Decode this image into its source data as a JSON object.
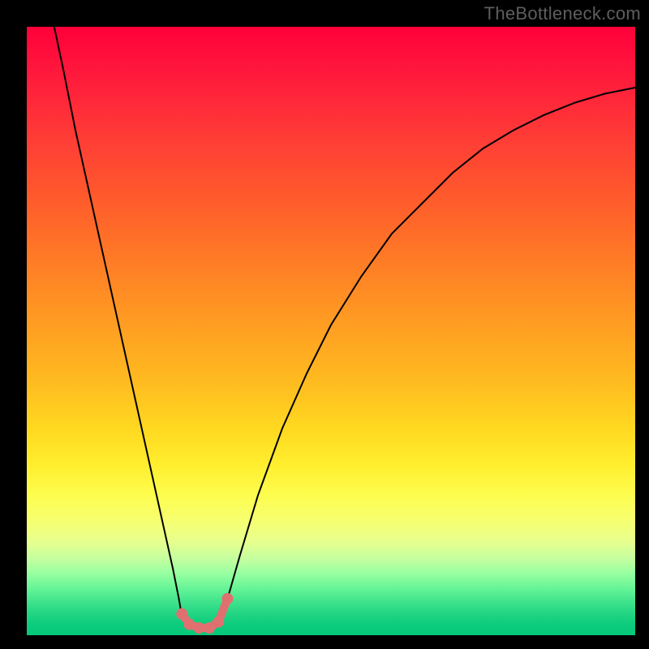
{
  "watermark": "TheBottleneck.com",
  "colors": {
    "frame": "#000000",
    "curve": "#000000",
    "marker": "#e07070",
    "gradient_top": "#ff003a",
    "gradient_bottom": "#04c878"
  },
  "chart_data": {
    "type": "line",
    "title": "",
    "xlabel": "",
    "ylabel": "",
    "xlim": [
      0,
      100
    ],
    "ylim": [
      0,
      100
    ],
    "grid": false,
    "legend": false,
    "note": "No axis ticks or numeric labels are shown; values below are read from pixel positions normalized to a 0–100 range (y=0 bottom/green, y=100 top/red).",
    "series": [
      {
        "name": "left-arm",
        "x": [
          4.5,
          6,
          8,
          10,
          12,
          14,
          16,
          18,
          20,
          22,
          24,
          25,
          25.5
        ],
        "values": [
          100,
          93,
          83,
          74,
          65,
          56,
          47,
          38,
          29,
          20,
          11,
          6,
          3
        ]
      },
      {
        "name": "valley",
        "x": [
          25.5,
          26.5,
          28,
          29.5,
          31,
          32,
          33
        ],
        "values": [
          3,
          1.5,
          1,
          1,
          1.5,
          3,
          6
        ]
      },
      {
        "name": "right-arm",
        "x": [
          33,
          35,
          38,
          42,
          46,
          50,
          55,
          60,
          65,
          70,
          75,
          80,
          85,
          90,
          95,
          100
        ],
        "values": [
          6,
          13,
          23,
          34,
          43,
          51,
          59,
          66,
          71,
          76,
          80,
          83,
          85.5,
          87.5,
          89,
          90
        ]
      }
    ],
    "markers": [
      {
        "x": 25.5,
        "y": 3.5
      },
      {
        "x": 26.7,
        "y": 1.8
      },
      {
        "x": 28.3,
        "y": 1.2
      },
      {
        "x": 30.0,
        "y": 1.2
      },
      {
        "x": 31.5,
        "y": 2.2
      },
      {
        "x": 33.0,
        "y": 6.0
      }
    ]
  }
}
